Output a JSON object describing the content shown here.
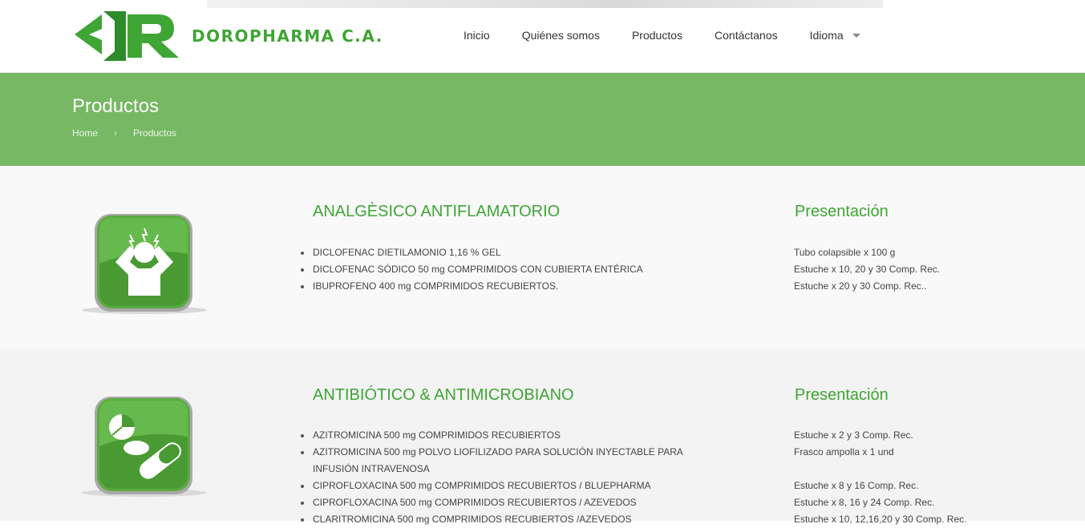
{
  "header": {
    "brand": "DOROPHARMA C.A.",
    "nav": [
      "Inicio",
      "Quiénes somos",
      "Productos",
      "Contáctanos",
      "Idioma"
    ]
  },
  "banner": {
    "title": "Productos",
    "breadcrumb": [
      "Home",
      "Productos"
    ]
  },
  "sections": [
    {
      "icon": "headache-person-icon",
      "title": "ANALGÈSICO ANTIFLAMATORIO",
      "presentation_title": "Presentación",
      "products": [
        "DICLOFENAC DIETILAMONIO 1,16 % GEL",
        "DICLOFENAC SÓDICO 50 mg COMPRIMIDOS CON CUBIERTA ENTÉRICA",
        "IBUPROFENO 400 mg COMPRIMIDOS RECUBIERTOS."
      ],
      "presentations": [
        "Tubo colapsible x 100 g",
        "Estuche x 10, 20 y 30 Comp. Rec.",
        "Estuche x 20 y 30 Comp. Rec.."
      ]
    },
    {
      "icon": "pills-capsule-icon",
      "title": "ANTIBIÓTICO & ANTIMICROBIANO",
      "presentation_title": "Presentación",
      "products": [
        "AZITROMICINA 500 mg COMPRIMIDOS RECUBIERTOS",
        "AZITROMICINA 500 mg POLVO LIOFILIZADO PARA SOLUCIÓN INYECTABLE PARA INFUSIÓN INTRAVENOSA",
        "CIPROFLOXACINA 500 mg COMPRIMIDOS RECUBIERTOS / BLUEPHARMA",
        "CIPROFLOXACINA 500 mg COMPRIMIDOS RECUBIERTOS / AZEVEDOS",
        "CLARITROMICINA 500 mg COMPRIMIDOS RECUBIERTOS /AZEVEDOS"
      ],
      "presentations": [
        "Estuche x 2 y 3 Comp. Rec.",
        "Frasco ampolla x 1 und",
        "",
        "Estuche x 8 y 16 Comp. Rec.",
        "Estuche x 8, 16 y 24 Comp. Rec.",
        "Estuche x 10, 12,16,20 y 30 Comp. Rec."
      ]
    }
  ],
  "colors": {
    "brand_green": "#3fa535",
    "banner_green": "#77b865",
    "icon_green": "#4fa33a"
  }
}
